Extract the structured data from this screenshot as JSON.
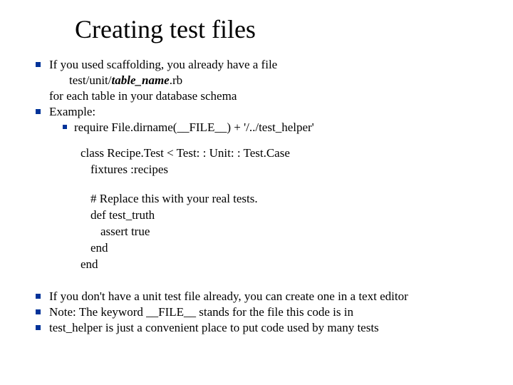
{
  "title": "Creating test files",
  "b1_line1": "If you used scaffolding, you already have a file",
  "b1_path_pre": "test/unit/",
  "b1_path_var": "table_name",
  "b1_path_post": ".rb",
  "b1_line3": "for each table in your database schema",
  "b2": "Example:",
  "b2_sub": "require File.dirname(__FILE__) + '/../test_helper'",
  "code_class": "class Recipe.Test < Test: : Unit: : Test.Case",
  "code_fixtures": "fixtures :recipes",
  "code_comment": "# Replace this with your real tests.",
  "code_def": "def test_truth",
  "code_assert": "assert true",
  "code_end1": "end",
  "code_end2": "end",
  "b3": "If you don't have a unit test file already, you can create one in a text editor",
  "b4_pre": "Note: The keyword ",
  "b4_key": "__FILE__",
  "b4_post": " stands for the file this code is in",
  "b5_pre": "test_helper",
  "b5_post": " is just a convenient place to put code used by many tests"
}
